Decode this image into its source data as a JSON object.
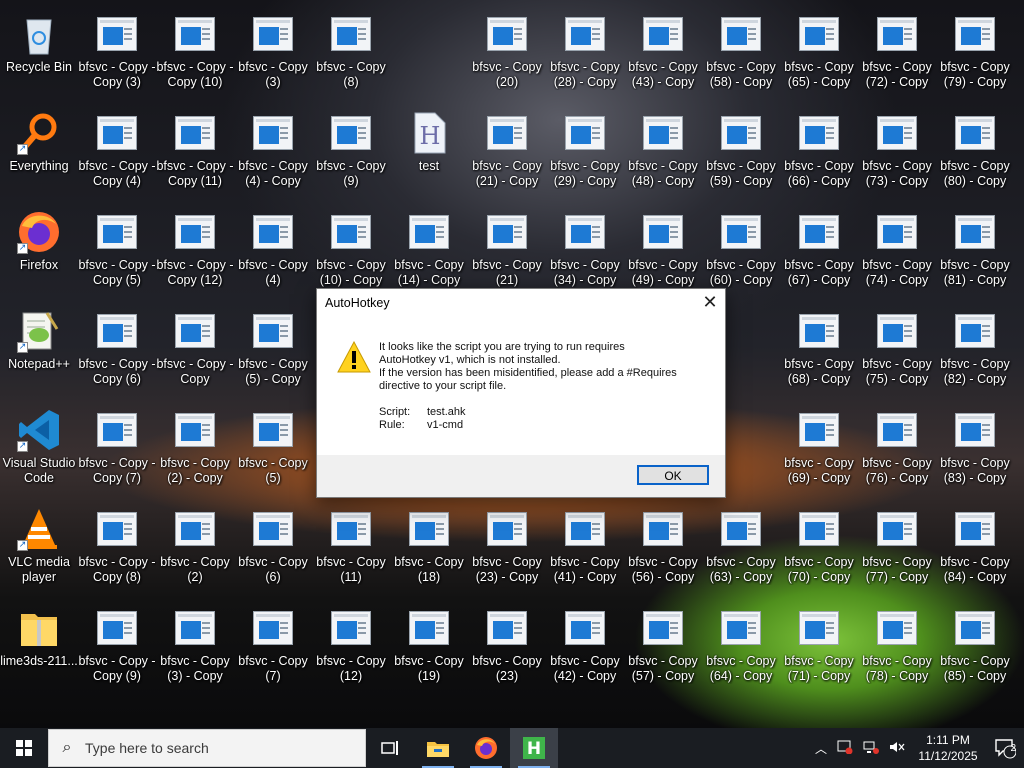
{
  "desktop_icons": [
    {
      "label": "Recycle Bin",
      "icon": "recycle-bin-icon",
      "col": 0,
      "row": 0
    },
    {
      "label": "Everything",
      "icon": "everything-search-icon",
      "col": 0,
      "row": 1
    },
    {
      "label": "Firefox",
      "icon": "firefox-icon",
      "col": 0,
      "row": 2
    },
    {
      "label": "Notepad++",
      "icon": "notepad-plus-plus-icon",
      "col": 0,
      "row": 3
    },
    {
      "label": "Visual Studio Code",
      "icon": "vscode-icon",
      "col": 0,
      "row": 4
    },
    {
      "label": "VLC media player",
      "icon": "vlc-icon",
      "col": 0,
      "row": 5
    },
    {
      "label": "lime3ds-211...",
      "icon": "zip-folder-icon",
      "col": 0,
      "row": 6
    },
    {
      "label": "bfsvc - Copy - Copy (3)",
      "icon": "app-window-icon",
      "col": 1,
      "row": 0
    },
    {
      "label": "bfsvc - Copy - Copy (4)",
      "icon": "app-window-icon",
      "col": 1,
      "row": 1
    },
    {
      "label": "bfsvc - Copy - Copy (5)",
      "icon": "app-window-icon",
      "col": 1,
      "row": 2
    },
    {
      "label": "bfsvc - Copy - Copy (6)",
      "icon": "app-window-icon",
      "col": 1,
      "row": 3
    },
    {
      "label": "bfsvc - Copy - Copy (7)",
      "icon": "app-window-icon",
      "col": 1,
      "row": 4
    },
    {
      "label": "bfsvc - Copy - Copy (8)",
      "icon": "app-window-icon",
      "col": 1,
      "row": 5
    },
    {
      "label": "bfsvc - Copy - Copy (9)",
      "icon": "app-window-icon",
      "col": 1,
      "row": 6
    },
    {
      "label": "bfsvc - Copy - Copy (10)",
      "icon": "app-window-icon",
      "col": 2,
      "row": 0
    },
    {
      "label": "bfsvc - Copy - Copy (11)",
      "icon": "app-window-icon",
      "col": 2,
      "row": 1
    },
    {
      "label": "bfsvc - Copy - Copy (12)",
      "icon": "app-window-icon",
      "col": 2,
      "row": 2
    },
    {
      "label": "bfsvc - Copy - Copy",
      "icon": "app-window-icon",
      "col": 2,
      "row": 3
    },
    {
      "label": "bfsvc - Copy (2) - Copy",
      "icon": "app-window-icon",
      "col": 2,
      "row": 4
    },
    {
      "label": "bfsvc - Copy (2)",
      "icon": "app-window-icon",
      "col": 2,
      "row": 5
    },
    {
      "label": "bfsvc - Copy (3) - Copy",
      "icon": "app-window-icon",
      "col": 2,
      "row": 6
    },
    {
      "label": "bfsvc - Copy (3)",
      "icon": "app-window-icon",
      "col": 3,
      "row": 0
    },
    {
      "label": "bfsvc - Copy (4) - Copy",
      "icon": "app-window-icon",
      "col": 3,
      "row": 1
    },
    {
      "label": "bfsvc - Copy (4)",
      "icon": "app-window-icon",
      "col": 3,
      "row": 2
    },
    {
      "label": "bfsvc - Copy (5) - Copy",
      "icon": "app-window-icon",
      "col": 3,
      "row": 3
    },
    {
      "label": "bfsvc - Copy (5)",
      "icon": "app-window-icon",
      "col": 3,
      "row": 4
    },
    {
      "label": "bfsvc - Copy (6)",
      "icon": "app-window-icon",
      "col": 3,
      "row": 5
    },
    {
      "label": "bfsvc - Copy (7)",
      "icon": "app-window-icon",
      "col": 3,
      "row": 6
    },
    {
      "label": "bfsvc - Copy (8)",
      "icon": "app-window-icon",
      "col": 4,
      "row": 0
    },
    {
      "label": "bfsvc - Copy (9)",
      "icon": "app-window-icon",
      "col": 4,
      "row": 1
    },
    {
      "label": "bfsvc - Copy (10) - Copy",
      "icon": "app-window-icon",
      "col": 4,
      "row": 2
    },
    {
      "label": "bfsvc - Copy (11)",
      "icon": "app-window-icon",
      "col": 4,
      "row": 5
    },
    {
      "label": "bfsvc - Copy (12)",
      "icon": "app-window-icon",
      "col": 4,
      "row": 6
    },
    {
      "label": "test",
      "icon": "autohotkey-script-icon",
      "col": 5,
      "row": 1
    },
    {
      "label": "bfsvc - Copy (14) - Copy",
      "icon": "app-window-icon",
      "col": 5,
      "row": 2
    },
    {
      "label": "bfsvc - Copy (18)",
      "icon": "app-window-icon",
      "col": 5,
      "row": 5
    },
    {
      "label": "bfsvc - Copy (19)",
      "icon": "app-window-icon",
      "col": 5,
      "row": 6
    },
    {
      "label": "bfsvc - Copy (20)",
      "icon": "app-window-icon",
      "col": 6,
      "row": 0
    },
    {
      "label": "bfsvc - Copy (21) - Copy",
      "icon": "app-window-icon",
      "col": 6,
      "row": 1
    },
    {
      "label": "bfsvc - Copy (21)",
      "icon": "app-window-icon",
      "col": 6,
      "row": 2
    },
    {
      "label": "bfsvc - Copy (23) - Copy",
      "icon": "app-window-icon",
      "col": 6,
      "row": 5
    },
    {
      "label": "bfsvc - Copy (23)",
      "icon": "app-window-icon",
      "col": 6,
      "row": 6
    },
    {
      "label": "bfsvc - Copy (28) - Copy",
      "icon": "app-window-icon",
      "col": 7,
      "row": 0
    },
    {
      "label": "bfsvc - Copy (29) - Copy",
      "icon": "app-window-icon",
      "col": 7,
      "row": 1
    },
    {
      "label": "bfsvc - Copy (34) - Copy",
      "icon": "app-window-icon",
      "col": 7,
      "row": 2
    },
    {
      "label": "bfsvc - Copy (41) - Copy",
      "icon": "app-window-icon",
      "col": 7,
      "row": 5
    },
    {
      "label": "bfsvc - Copy (42) - Copy",
      "icon": "app-window-icon",
      "col": 7,
      "row": 6
    },
    {
      "label": "bfsvc - Copy (43) - Copy",
      "icon": "app-window-icon",
      "col": 8,
      "row": 0
    },
    {
      "label": "bfsvc - Copy (48) - Copy",
      "icon": "app-window-icon",
      "col": 8,
      "row": 1
    },
    {
      "label": "bfsvc - Copy (49) - Copy",
      "icon": "app-window-icon",
      "col": 8,
      "row": 2
    },
    {
      "label": "bfsvc - Copy (56) - Copy",
      "icon": "app-window-icon",
      "col": 8,
      "row": 5
    },
    {
      "label": "bfsvc - Copy (57) - Copy",
      "icon": "app-window-icon",
      "col": 8,
      "row": 6
    },
    {
      "label": "bfsvc - Copy (58) - Copy",
      "icon": "app-window-icon",
      "col": 9,
      "row": 0
    },
    {
      "label": "bfsvc - Copy (59) - Copy",
      "icon": "app-window-icon",
      "col": 9,
      "row": 1
    },
    {
      "label": "bfsvc - Copy (60) - Copy",
      "icon": "app-window-icon",
      "col": 9,
      "row": 2
    },
    {
      "label": "bfsvc - Copy (63) - Copy",
      "icon": "app-window-icon",
      "col": 9,
      "row": 5
    },
    {
      "label": "bfsvc - Copy (64) - Copy",
      "icon": "app-window-icon",
      "col": 9,
      "row": 6
    },
    {
      "label": "bfsvc - Copy (65) - Copy",
      "icon": "app-window-icon",
      "col": 10,
      "row": 0
    },
    {
      "label": "bfsvc - Copy (66) - Copy",
      "icon": "app-window-icon",
      "col": 10,
      "row": 1
    },
    {
      "label": "bfsvc - Copy (67) - Copy",
      "icon": "app-window-icon",
      "col": 10,
      "row": 2
    },
    {
      "label": "bfsvc - Copy (68) - Copy",
      "icon": "app-window-icon",
      "col": 10,
      "row": 3
    },
    {
      "label": "bfsvc - Copy (69) - Copy",
      "icon": "app-window-icon",
      "col": 10,
      "row": 4
    },
    {
      "label": "bfsvc - Copy (70) - Copy",
      "icon": "app-window-icon",
      "col": 10,
      "row": 5
    },
    {
      "label": "bfsvc - Copy (71) - Copy",
      "icon": "app-window-icon",
      "col": 10,
      "row": 6
    },
    {
      "label": "bfsvc - Copy (72) - Copy",
      "icon": "app-window-icon",
      "col": 11,
      "row": 0
    },
    {
      "label": "bfsvc - Copy (73) - Copy",
      "icon": "app-window-icon",
      "col": 11,
      "row": 1
    },
    {
      "label": "bfsvc - Copy (74) - Copy",
      "icon": "app-window-icon",
      "col": 11,
      "row": 2
    },
    {
      "label": "bfsvc - Copy (75) - Copy",
      "icon": "app-window-icon",
      "col": 11,
      "row": 3
    },
    {
      "label": "bfsvc - Copy (76) - Copy",
      "icon": "app-window-icon",
      "col": 11,
      "row": 4
    },
    {
      "label": "bfsvc - Copy (77) - Copy",
      "icon": "app-window-icon",
      "col": 11,
      "row": 5
    },
    {
      "label": "bfsvc - Copy (78) - Copy",
      "icon": "app-window-icon",
      "col": 11,
      "row": 6
    },
    {
      "label": "bfsvc - Copy (79) - Copy",
      "icon": "app-window-icon",
      "col": 12,
      "row": 0
    },
    {
      "label": "bfsvc - Copy (80) - Copy",
      "icon": "app-window-icon",
      "col": 12,
      "row": 1
    },
    {
      "label": "bfsvc - Copy (81) - Copy",
      "icon": "app-window-icon",
      "col": 12,
      "row": 2
    },
    {
      "label": "bfsvc - Copy (82) - Copy",
      "icon": "app-window-icon",
      "col": 12,
      "row": 3
    },
    {
      "label": "bfsvc - Copy (83) - Copy",
      "icon": "app-window-icon",
      "col": 12,
      "row": 4
    },
    {
      "label": "bfsvc - Copy (84) - Copy",
      "icon": "app-window-icon",
      "col": 12,
      "row": 5
    },
    {
      "label": "bfsvc - Copy (85) - Copy",
      "icon": "app-window-icon",
      "col": 12,
      "row": 6
    }
  ],
  "dialog": {
    "title": "AutoHotkey",
    "close": "✕",
    "message_line1": "It looks like the script you are trying to run requires",
    "message_line2": "AutoHotkey v1, which is not installed.",
    "message_line3": "If the version has been misidentified, please add a #Requires",
    "message_line4": "directive to your script file.",
    "script_key": "Script:",
    "script_value": "test.ahk",
    "rule_key": "Rule:",
    "rule_value": "v1-cmd",
    "ok_label": "OK"
  },
  "taskbar": {
    "search_placeholder": "Type here to search",
    "time": "1:11 PM",
    "date": "11/12/2025",
    "notification_count": "2",
    "pinned": [
      "task-view-icon",
      "file-explorer-icon",
      "firefox-icon",
      "autohotkey-icon"
    ],
    "active": "autohotkey-icon",
    "accent": "#7fb2f0"
  }
}
